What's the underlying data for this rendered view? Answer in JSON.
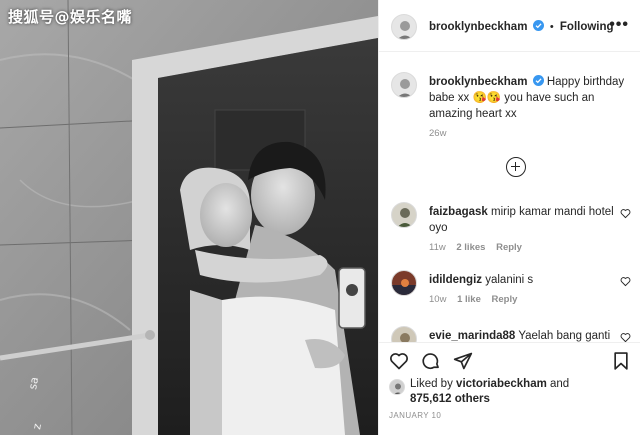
{
  "watermark": "搜狐号@娱乐名嘴",
  "post": {
    "author": "brooklynbeckham",
    "follow_label": "Following",
    "dot": "•",
    "more": "•••",
    "caption": "Happy birthday babe xx 😘😘 you have such an amazing heart xx",
    "caption_time": "26w"
  },
  "comments": [
    {
      "user": "faizbagask",
      "text": "mirip kamar mandi hotel oyo",
      "time": "11w",
      "likes": "2 likes",
      "reply": "Reply"
    },
    {
      "user": "idildengiz",
      "text": "yalanini s",
      "time": "10w",
      "likes": "1 like",
      "reply": "Reply"
    },
    {
      "user": "evie_marinda88",
      "text": "Yaelah bang ganti",
      "time": "",
      "likes": "",
      "reply": ""
    }
  ],
  "actions": {
    "icons": [
      "heart-icon",
      "comment-icon",
      "share-icon",
      "save-icon"
    ]
  },
  "likes": {
    "prefix": "Liked by",
    "by": "victoriabeckham",
    "and": "and",
    "others": "875,612 others"
  },
  "date": "JANUARY 10",
  "colors": {
    "verified": "#3897f0",
    "meta": "#8e8e8e",
    "text": "#262626"
  }
}
